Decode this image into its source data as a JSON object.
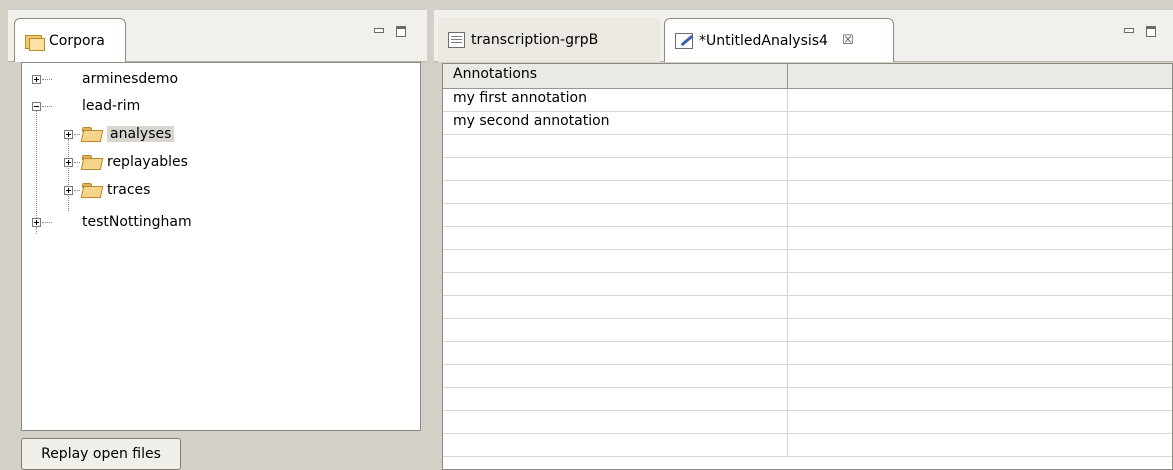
{
  "left_view": {
    "tab_label": "Corpora",
    "icons": {
      "tab": "corpora-icon",
      "minimize": "minimize-icon",
      "maximize": "maximize-icon"
    },
    "tree": [
      {
        "label": "arminesdemo",
        "expanded": false
      },
      {
        "label": "lead-rim",
        "expanded": true
      },
      {
        "label": "analyses",
        "expanded": false,
        "selected": true
      },
      {
        "label": "replayables",
        "expanded": false
      },
      {
        "label": "traces",
        "expanded": false
      },
      {
        "label": "testNottingham",
        "expanded": false
      }
    ],
    "replay_button_label": "Replay open files"
  },
  "right_view": {
    "tabs": [
      {
        "label": "transcription-grpB",
        "active": false,
        "icon": "table-doc-icon"
      },
      {
        "label": "*UntitledAnalysis4",
        "active": true,
        "icon": "edit-doc-icon",
        "close_glyph": "☒"
      }
    ],
    "table": {
      "columns": [
        "Annotations",
        ""
      ],
      "rows": [
        [
          "my first annotation",
          ""
        ],
        [
          "my second annotation",
          ""
        ]
      ]
    }
  },
  "colors": {
    "background": "#d4d0c8",
    "selection": "#d9d6cf",
    "folder": "#f6d58a"
  }
}
